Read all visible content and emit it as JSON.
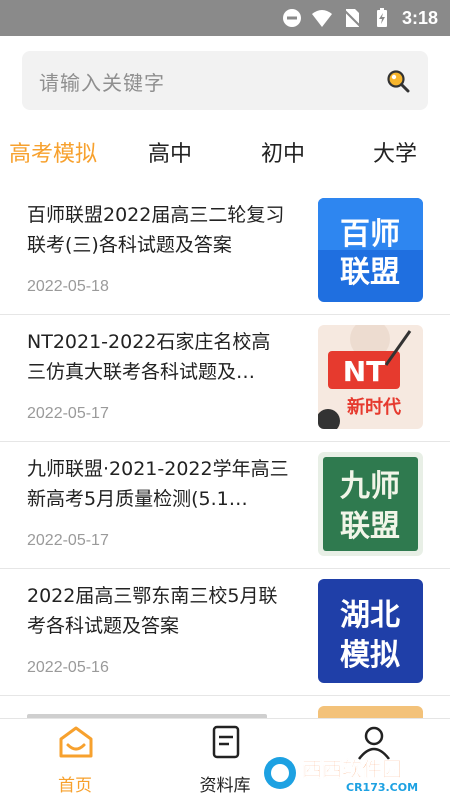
{
  "status_bar": {
    "time": "3:18",
    "icons": [
      "do-not-disturb-icon",
      "wifi-icon",
      "no-sim-icon",
      "battery-charging-icon"
    ]
  },
  "search": {
    "placeholder": "请输入关键字",
    "icon": "search-icon"
  },
  "tabs": [
    {
      "label": "高考模拟",
      "active": true
    },
    {
      "label": "高中",
      "active": false
    },
    {
      "label": "初中",
      "active": false
    },
    {
      "label": "大学",
      "active": false
    }
  ],
  "articles": [
    {
      "title": "百师联盟2022届高三二轮复习联考(三)各科试题及答案",
      "date": "2022-05-18",
      "thumb": {
        "text1": "百师",
        "text2": "联盟",
        "bg": "#1f6fe0"
      }
    },
    {
      "title": "NT2021-2022石家庄名校高三仿真大联考各科试题及…",
      "date": "2022-05-17",
      "thumb": {
        "text1": "NT",
        "text2": "新时代",
        "bg": "#f6e9e0"
      }
    },
    {
      "title": "九师联盟·2021-2022学年高三新高考5月质量检测(5.1…",
      "date": "2022-05-17",
      "thumb": {
        "text1": "九师",
        "text2": "联盟",
        "bg": "#2f7a4f"
      }
    },
    {
      "title": "2022届高三鄂东南三校5月联考各科试题及答案",
      "date": "2022-05-16",
      "thumb": {
        "text1": "湖北",
        "text2": "模拟",
        "bg": "#1f3fa8"
      }
    }
  ],
  "bottom_nav": [
    {
      "label": "首页",
      "icon": "home-icon",
      "active": true
    },
    {
      "label": "资料库",
      "icon": "document-icon",
      "active": false
    },
    {
      "label": "",
      "icon": "user-icon",
      "active": false
    }
  ],
  "watermark": {
    "line1": "西西软件园",
    "line2": "CR173.COM"
  },
  "colors": {
    "accent": "#f7a12e",
    "status_bar": "#8a8a8a"
  }
}
